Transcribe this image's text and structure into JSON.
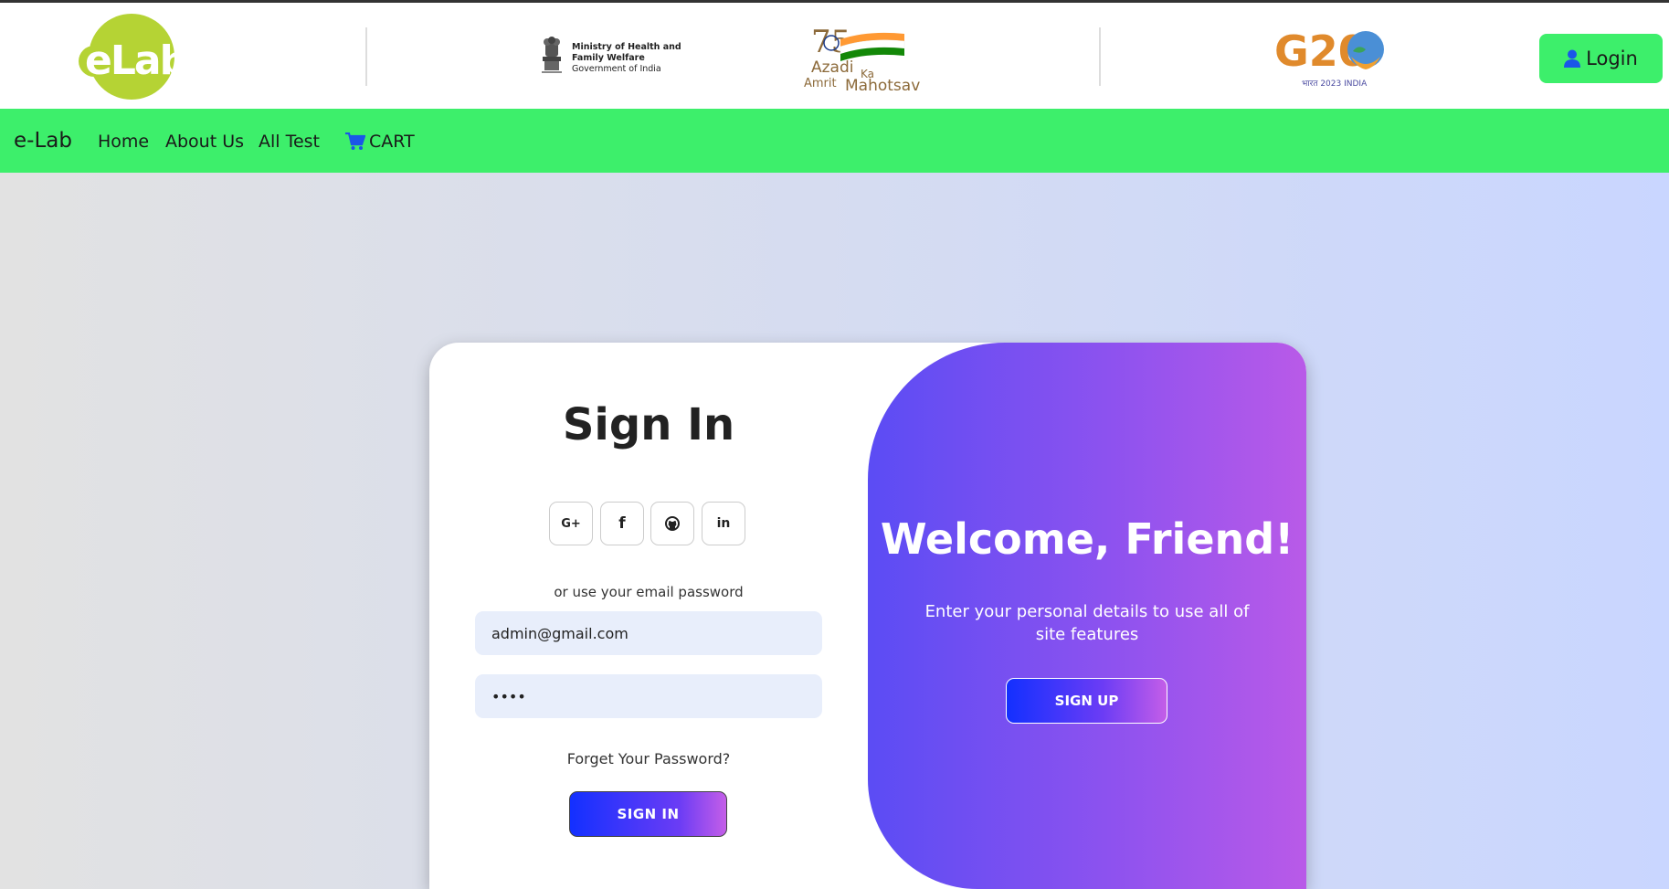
{
  "header": {
    "logo_text": "eLab",
    "ministry": {
      "line1": "Ministry of Health and",
      "line2": "Family Welfare",
      "line3": "Government of India"
    },
    "azadi": {
      "number": "75",
      "line1": "Azadi",
      "ka": "Ka",
      "amrit": "Amrit",
      "mahotsav": "Mahotsav"
    },
    "g20": {
      "text": "G20",
      "subtext": "भारत 2023 INDIA"
    },
    "login_label": "Login"
  },
  "navbar": {
    "brand": "e-Lab",
    "links": [
      "Home",
      "About Us",
      "All Test"
    ],
    "cart_label": "CART"
  },
  "signin": {
    "title": "Sign In",
    "social": [
      "G+",
      "f",
      "github",
      "in"
    ],
    "alt_text": "or use your email password",
    "email_value": "admin@gmail.com",
    "password_value": "••••",
    "forgot": "Forget Your Password?",
    "button": "SIGN IN"
  },
  "welcome": {
    "title": "Welcome, Friend!",
    "desc": "Enter your personal details to use all of site features",
    "button": "SIGN UP"
  },
  "colors": {
    "nav_green": "#3def6b",
    "purple_start": "#5b4cf4",
    "purple_end": "#b95ae8",
    "logo_green": "#b5d334"
  }
}
